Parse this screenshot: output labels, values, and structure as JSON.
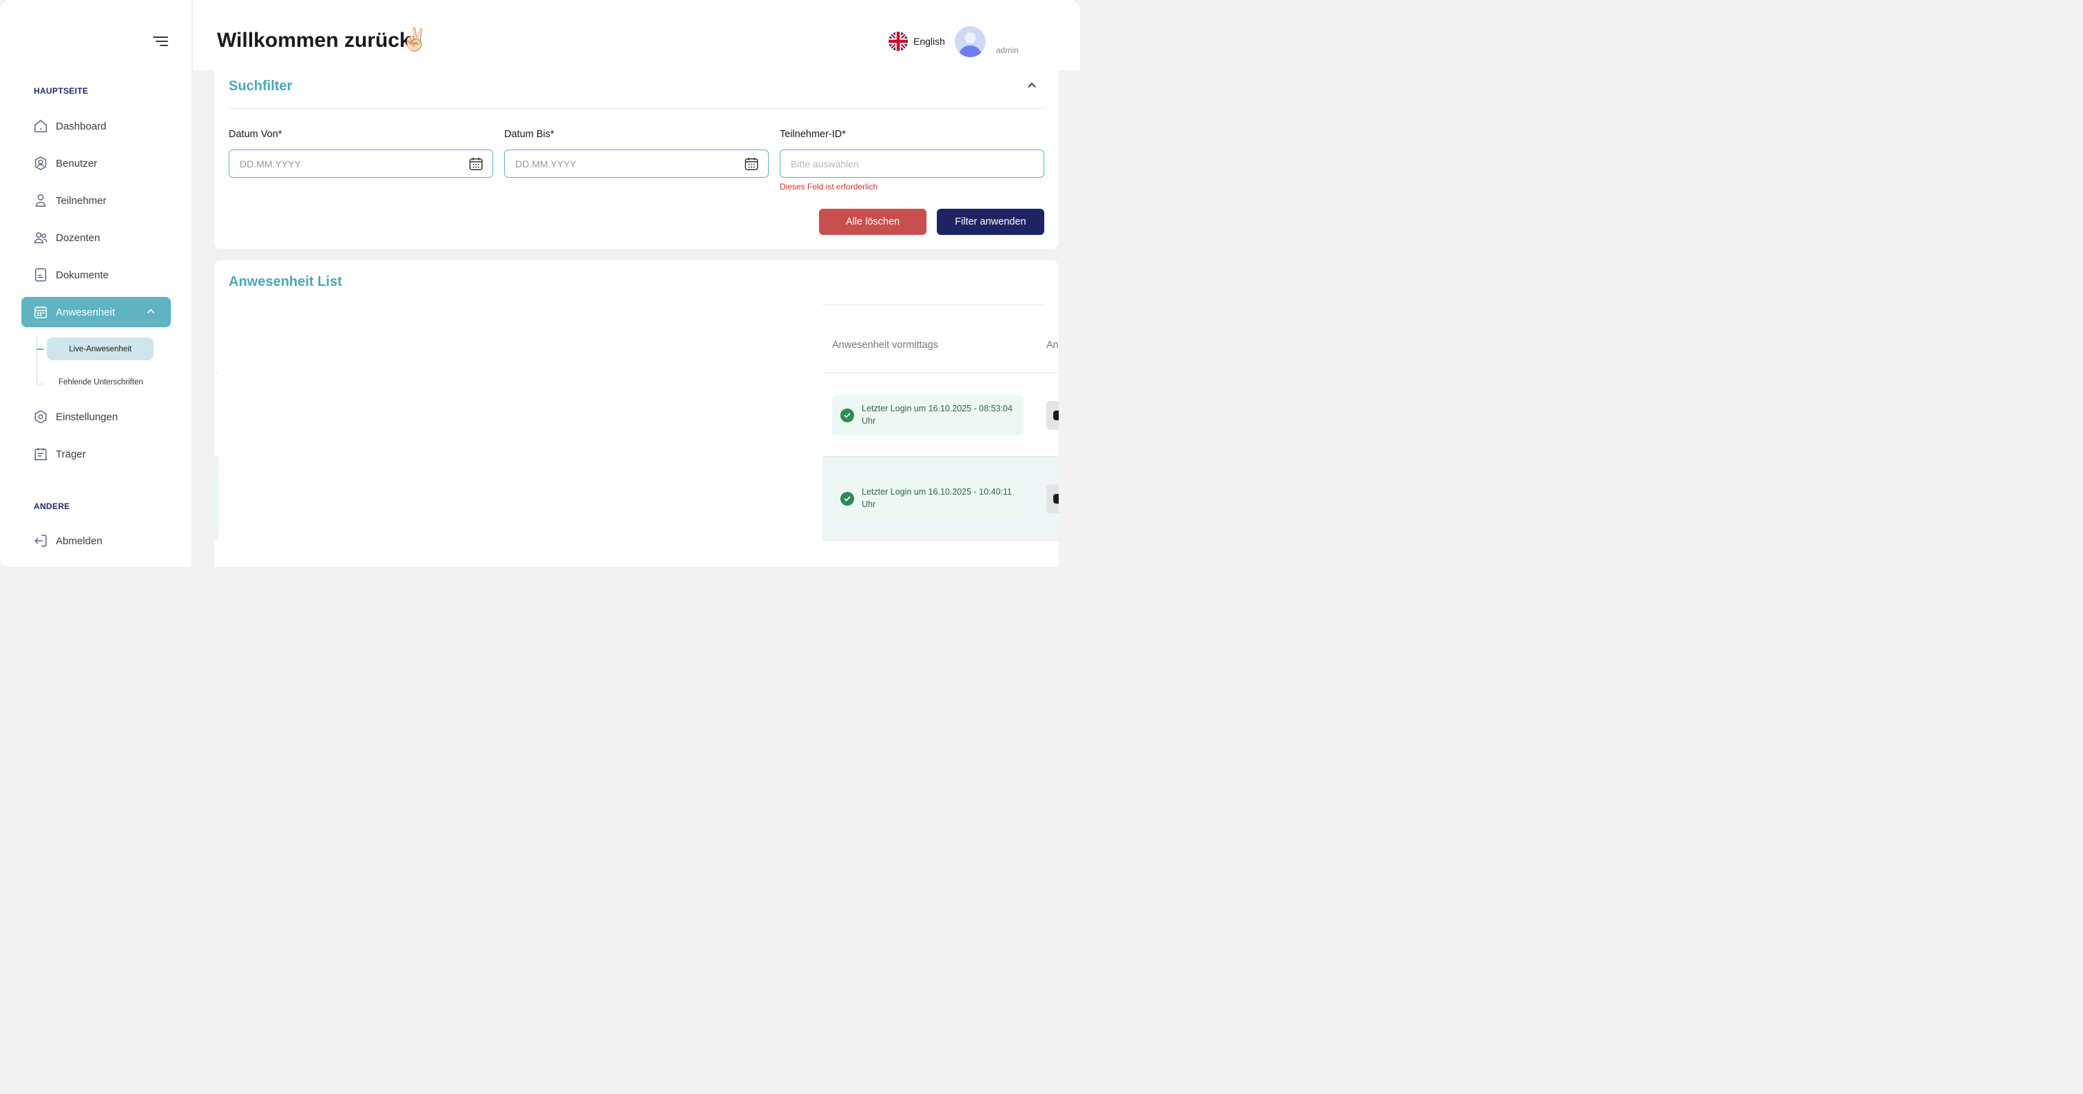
{
  "header": {
    "title": "Willkommen zurück",
    "emoji": "✌🏻",
    "language": "English",
    "username": "admin"
  },
  "sidebar": {
    "section_main": "HAUPTSEITE",
    "section_other": "ANDERE",
    "items": [
      {
        "label": "Dashboard",
        "icon": "home-icon"
      },
      {
        "label": "Benutzer",
        "icon": "user-shield-icon"
      },
      {
        "label": "Teilnehmer",
        "icon": "person-icon"
      },
      {
        "label": "Dozenten",
        "icon": "users-icon"
      },
      {
        "label": "Dokumente",
        "icon": "document-icon"
      },
      {
        "label": "Anwesenheit",
        "icon": "calendar-icon"
      },
      {
        "label": "Einstellungen",
        "icon": "settings-icon"
      },
      {
        "label": "Träger",
        "icon": "clipboard-icon"
      }
    ],
    "sub_items": [
      {
        "label": "Live-Anwesenheit"
      },
      {
        "label": "Fehlende Unterschriften"
      }
    ],
    "logout": "Abmelden"
  },
  "filter": {
    "title": "Suchfilter",
    "date_from_label": "Datum Von*",
    "date_from_placeholder": "DD.MM.YYYY",
    "date_to_label": "Datum Bis*",
    "date_to_placeholder": "DD.MM.YYYY",
    "participant_label": "Teilnehmer-ID*",
    "participant_placeholder": "Bitte auswählen",
    "participant_error": "Dieses Feld ist erforderlich",
    "clear_button": "Alle löschen",
    "apply_button": "Filter anwenden"
  },
  "list": {
    "title": "Anwesenheit List",
    "columns": [
      "Anwesenheit vormittags",
      "An"
    ],
    "rows": [
      {
        "status": "Letzter Login um 16.10.2025 - 08:53:04 Uhr"
      },
      {
        "status": "Letzter Login um 16.10.2025 - 10:40:11 Uhr"
      }
    ]
  },
  "colors": {
    "accent": "#5fb3c2",
    "title_accent": "#4ea6b8",
    "navy": "#1e2463",
    "danger": "#c84f4f",
    "success": "#2e8b57"
  }
}
